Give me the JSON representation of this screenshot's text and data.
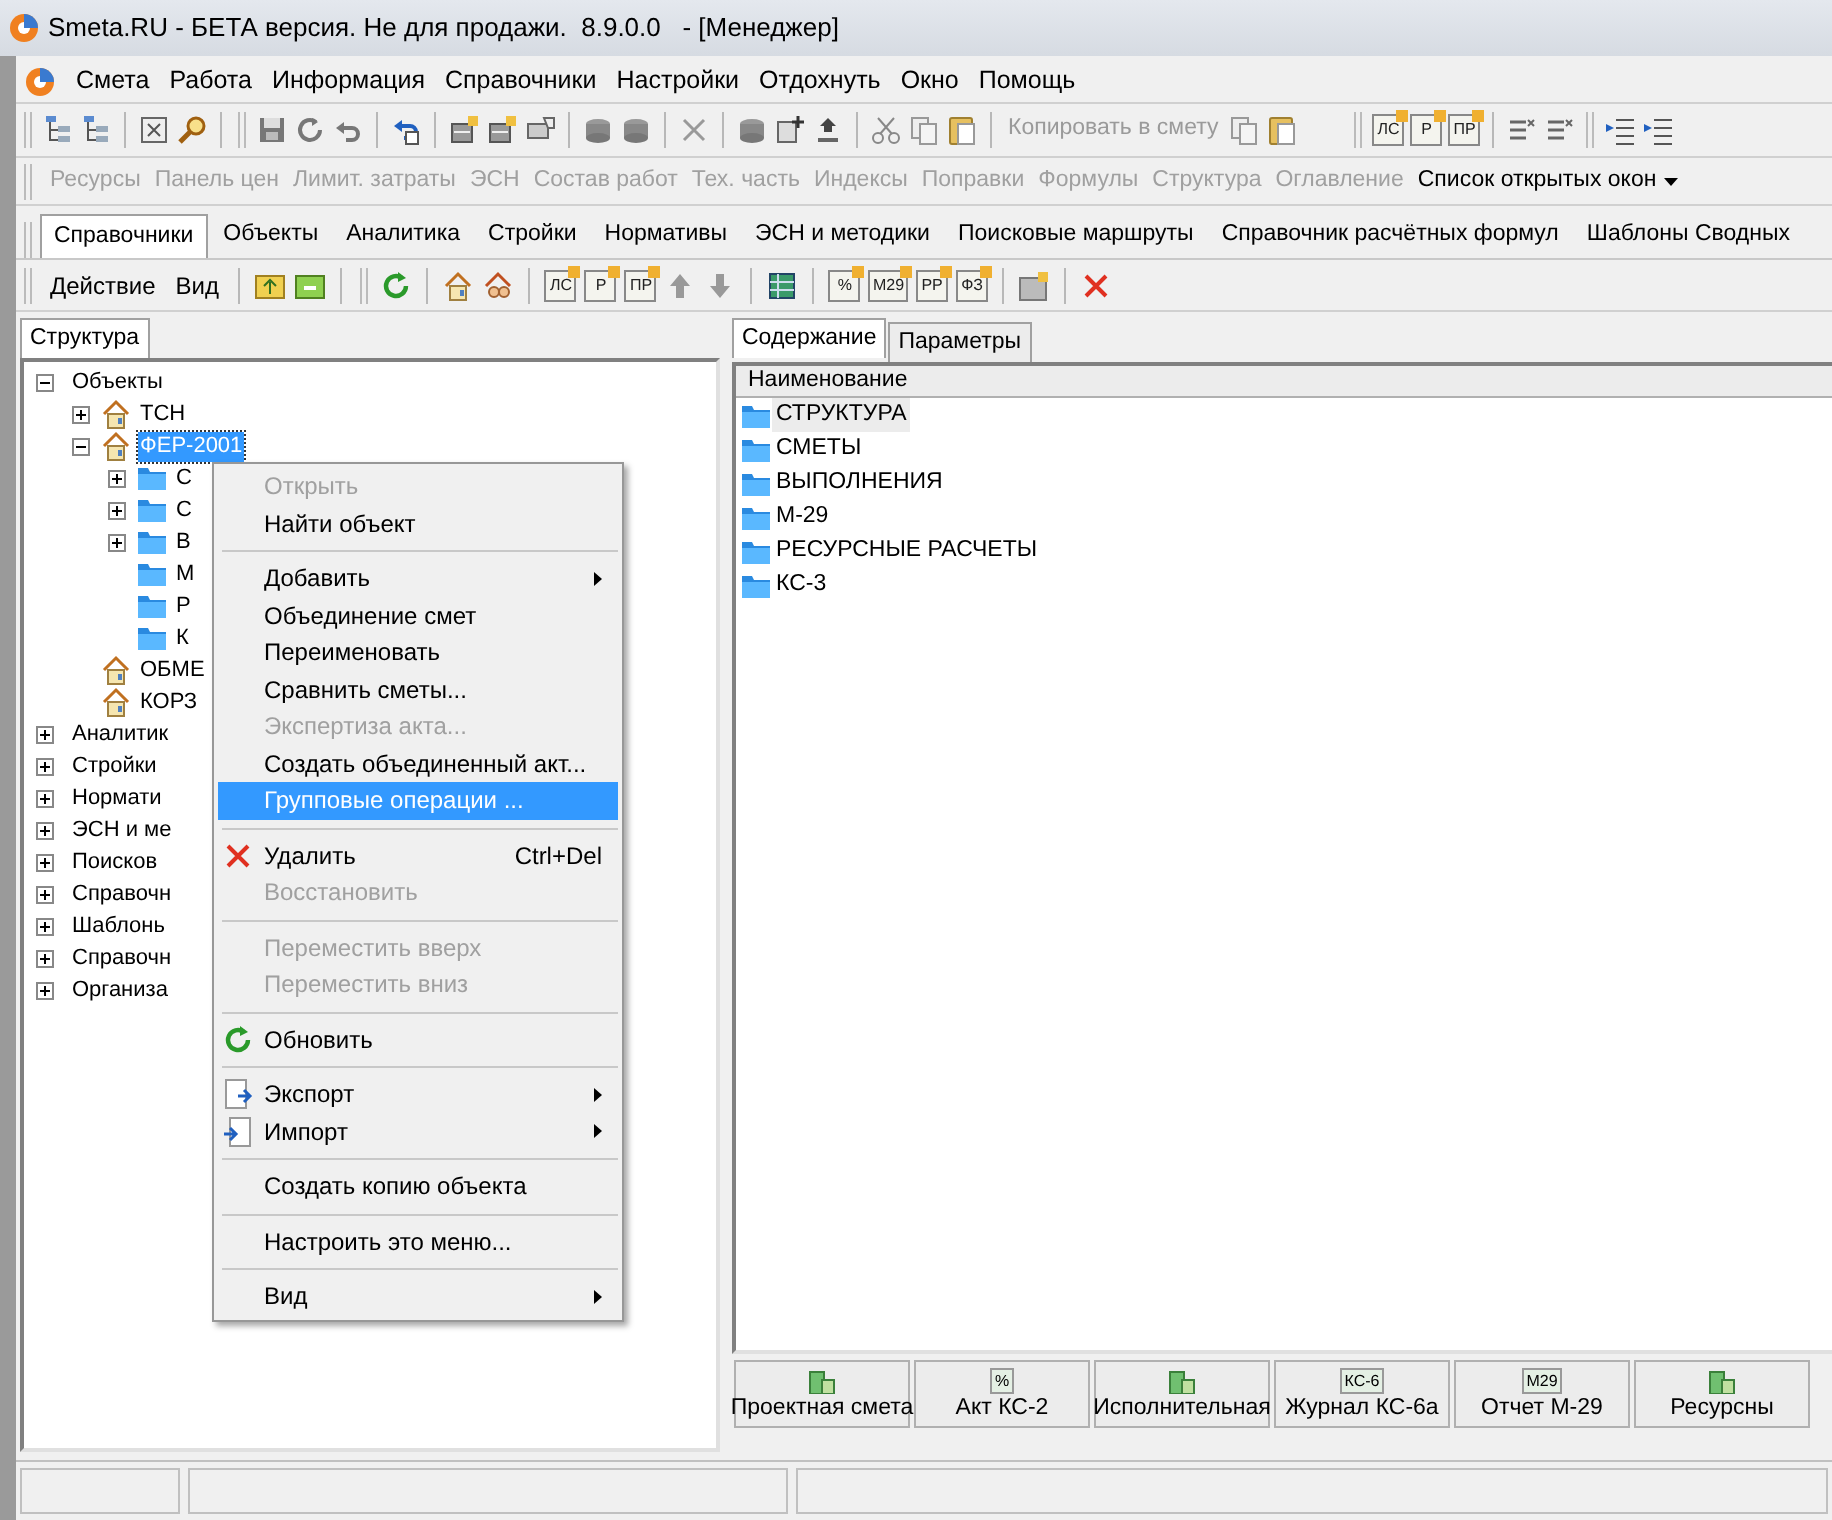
{
  "window": {
    "title": "Smeta.RU - БЕТА версия. Не для продажи.  8.9.0.0   - [Менеджер]"
  },
  "menu_bar": [
    "Смета",
    "Работа",
    "Информация",
    "Справочники",
    "Настройки",
    "Отдохнуть",
    "Окно",
    "Помощь"
  ],
  "main_toolbar": {
    "copy_button": {
      "label": "Копировать в смету",
      "disabled": true
    },
    "tags": [
      "ЛС",
      "Р",
      "ПР"
    ]
  },
  "panels_toolbar": {
    "items": [
      {
        "label": "Ресурсы",
        "disabled": true
      },
      {
        "label": "Панель цен",
        "disabled": true
      },
      {
        "label": "Лимит. затраты",
        "disabled": true
      },
      {
        "label": "ЭСН",
        "disabled": true
      },
      {
        "label": "Состав работ",
        "disabled": true
      },
      {
        "label": "Тех. часть",
        "disabled": true
      },
      {
        "label": "Индексы",
        "disabled": true
      },
      {
        "label": "Поправки",
        "disabled": true
      },
      {
        "label": "Формулы",
        "disabled": true
      },
      {
        "label": "Структура",
        "disabled": true
      },
      {
        "label": "Оглавление",
        "disabled": true
      }
    ],
    "dropdown": "Список открытых окон"
  },
  "tabs": [
    {
      "label": "Справочники",
      "selected": true
    },
    {
      "label": "Объекты",
      "selected": false
    },
    {
      "label": "Аналитика",
      "selected": false
    },
    {
      "label": "Стройки",
      "selected": false
    },
    {
      "label": "Нормативы",
      "selected": false
    },
    {
      "label": "ЭСН и методики",
      "selected": false
    },
    {
      "label": "Поисковые маршруты",
      "selected": false
    },
    {
      "label": "Справочник расчётных формул",
      "selected": false
    },
    {
      "label": "Шаблоны Сводных",
      "selected": false
    }
  ],
  "action_toolbar": {
    "buttons": [
      "Действие",
      "Вид"
    ],
    "tags_1": [
      "ЛС",
      "Р",
      "ПР"
    ],
    "tags_2": [
      "%",
      "М29",
      "РР",
      "ФЗ"
    ]
  },
  "left_panel": {
    "tab": "Структура",
    "tree": [
      {
        "label": "Объекты",
        "expanded": true,
        "selected": false,
        "children": [
          {
            "label": "ТСН",
            "expanded": false,
            "selected": false
          },
          {
            "label": "ФЕР-2001",
            "expanded": true,
            "selected": true,
            "children": [
              {
                "label": "С",
                "expanded": false,
                "selected": false
              },
              {
                "label": "С",
                "expanded": false,
                "selected": false
              },
              {
                "label": "В",
                "expanded": false,
                "selected": false
              },
              {
                "label": "М",
                "selected": false
              },
              {
                "label": "Р",
                "selected": false
              },
              {
                "label": "К",
                "selected": false
              }
            ]
          },
          {
            "label": "ОБМЕ",
            "selected": false
          },
          {
            "label": "КОРЗ",
            "selected": false
          }
        ]
      },
      {
        "label": "Аналитик",
        "expanded": false,
        "selected": false
      },
      {
        "label": "Стройки",
        "expanded": false,
        "selected": false
      },
      {
        "label": "Нормати",
        "expanded": false,
        "selected": false
      },
      {
        "label": "ЭСН и ме",
        "expanded": false,
        "selected": false
      },
      {
        "label": "Поисков",
        "expanded": false,
        "selected": false
      },
      {
        "label": "Справочн",
        "expanded": false,
        "selected": false
      },
      {
        "label": "Шаблонь",
        "expanded": false,
        "selected": false
      },
      {
        "label": "Справочн",
        "expanded": false,
        "selected": false
      },
      {
        "label": "Организа",
        "expanded": false,
        "selected": false
      }
    ]
  },
  "context_menu": [
    {
      "kind": "item",
      "label": "Открыть",
      "disabled": true,
      "selected": false
    },
    {
      "kind": "item",
      "label": "Найти объект",
      "disabled": false,
      "selected": false
    },
    {
      "kind": "separator"
    },
    {
      "kind": "item",
      "label": "Добавить",
      "disabled": false,
      "selected": false,
      "submenu": true
    },
    {
      "kind": "item",
      "label": "Объединение смет",
      "disabled": false,
      "selected": false
    },
    {
      "kind": "item",
      "label": "Переименовать",
      "disabled": false,
      "selected": false
    },
    {
      "kind": "item",
      "label": "Сравнить сметы...",
      "disabled": false,
      "selected": false
    },
    {
      "kind": "item",
      "label": "Экспертиза акта...",
      "disabled": true,
      "selected": false
    },
    {
      "kind": "item",
      "label": "Создать объединенный акт...",
      "disabled": false,
      "selected": false
    },
    {
      "kind": "item",
      "label": "Групповые операции ...",
      "disabled": false,
      "selected": true
    },
    {
      "kind": "separator"
    },
    {
      "kind": "item",
      "label": "Удалить",
      "disabled": false,
      "selected": false,
      "shortcut": "Ctrl+Del"
    },
    {
      "kind": "item",
      "label": "Восстановить",
      "disabled": true,
      "selected": false
    },
    {
      "kind": "separator"
    },
    {
      "kind": "item",
      "label": "Переместить вверх",
      "disabled": true,
      "selected": false
    },
    {
      "kind": "item",
      "label": "Переместить вниз",
      "disabled": true,
      "selected": false
    },
    {
      "kind": "separator"
    },
    {
      "kind": "item",
      "label": "Обновить",
      "disabled": false,
      "selected": false
    },
    {
      "kind": "separator"
    },
    {
      "kind": "item",
      "label": "Экспорт",
      "disabled": false,
      "selected": false,
      "submenu": true
    },
    {
      "kind": "item",
      "label": "Импорт",
      "disabled": false,
      "selected": false,
      "submenu": true
    },
    {
      "kind": "separator"
    },
    {
      "kind": "item",
      "label": "Создать копию объекта",
      "disabled": false,
      "selected": false
    },
    {
      "kind": "separator"
    },
    {
      "kind": "item",
      "label": "Настроить это меню...",
      "disabled": false,
      "selected": false
    },
    {
      "kind": "separator"
    },
    {
      "kind": "item",
      "label": "Вид",
      "disabled": false,
      "selected": false,
      "submenu": true
    }
  ],
  "right_panel": {
    "tabs": [
      {
        "label": "Содержание",
        "selected": true
      },
      {
        "label": "Параметры",
        "selected": false
      }
    ],
    "column": "Наименование",
    "rows": [
      {
        "label": "СТРУКТУРА",
        "selected": true
      },
      {
        "label": "СМЕТЫ",
        "selected": false
      },
      {
        "label": "ВЫПОЛНЕНИЯ",
        "selected": false
      },
      {
        "label": "М-29",
        "selected": false
      },
      {
        "label": "РЕСУРСНЫЕ РАСЧЕТЫ",
        "selected": false
      },
      {
        "label": "КС-3",
        "selected": false
      }
    ],
    "bottom_buttons": [
      {
        "label": "Проектная смета"
      },
      {
        "label": "Акт КС-2",
        "icon_text": "%"
      },
      {
        "label": "Исполнительная"
      },
      {
        "label": "Журнал КС-6а",
        "icon_text": "КС-6"
      },
      {
        "label": "Отчет М-29",
        "icon_text": "М29"
      },
      {
        "label": "Ресурсны"
      }
    ]
  }
}
